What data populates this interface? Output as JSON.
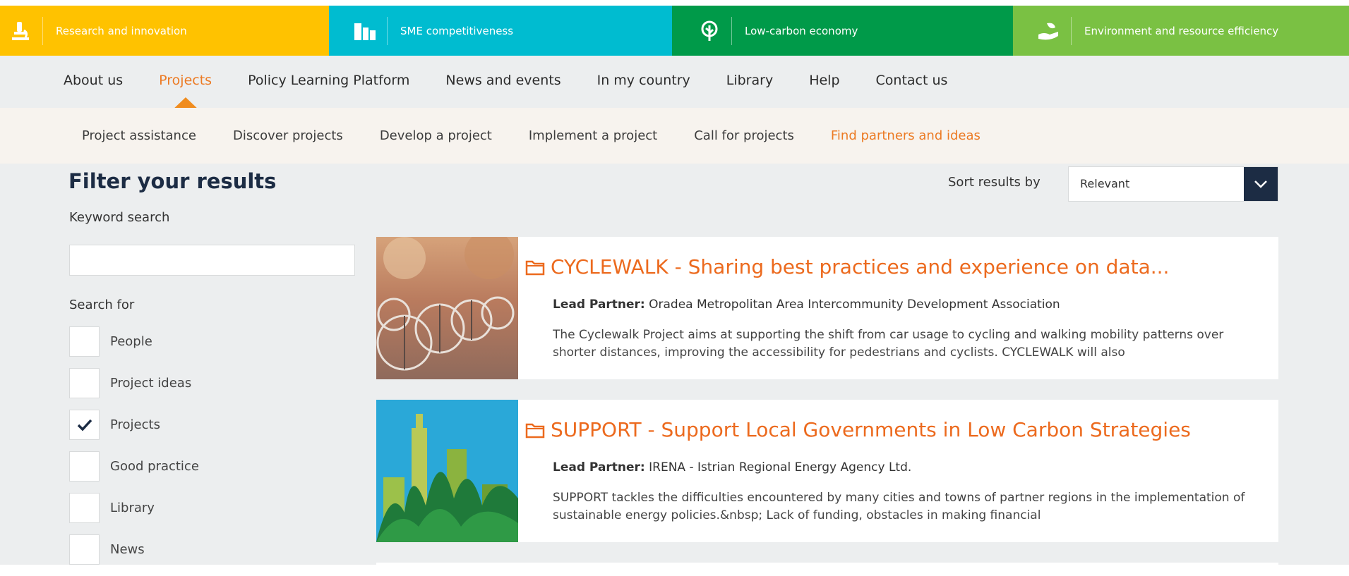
{
  "themes": [
    {
      "label": "Research and innovation",
      "color": "#ffc200",
      "icon": "microscope-icon"
    },
    {
      "label": "SME competitiveness",
      "color": "#00bcd0",
      "icon": "buildings-icon"
    },
    {
      "label": "Low-carbon economy",
      "color": "#009a49",
      "icon": "tree-icon"
    },
    {
      "label": "Environment and resource efficiency",
      "color": "#7ac143",
      "icon": "hand-leaf-icon"
    }
  ],
  "main_nav": {
    "items": [
      "About us",
      "Projects",
      "Policy Learning Platform",
      "News and events",
      "In my country",
      "Library",
      "Help",
      "Contact us"
    ],
    "active": "Projects"
  },
  "sub_nav": {
    "items": [
      "Project assistance",
      "Discover projects",
      "Develop a project",
      "Implement a project",
      "Call for projects",
      "Find partners and ideas"
    ],
    "active": "Find partners and ideas"
  },
  "filters": {
    "title": "Filter your results",
    "keyword_label": "Keyword search",
    "keyword_value": "",
    "search_for_label": "Search for",
    "options": [
      {
        "label": "People",
        "checked": false
      },
      {
        "label": "Project ideas",
        "checked": false
      },
      {
        "label": "Projects",
        "checked": true
      },
      {
        "label": "Good practice",
        "checked": false
      },
      {
        "label": "Library",
        "checked": false
      },
      {
        "label": "News",
        "checked": false
      }
    ]
  },
  "sort": {
    "label": "Sort results by",
    "value": "Relevant"
  },
  "results": [
    {
      "title": "CYCLEWALK - Sharing best practices and experience on data...",
      "lead_partner_label": "Lead Partner:",
      "lead_partner": " Oradea Metropolitan Area Intercommunity Development Association",
      "description": "The Cyclewalk Project aims at supporting the shift from car usage to cycling and walking mobility patterns over shorter distances, improving the accessibility for pedestrians and cyclists. CYCLEWALK will also",
      "image": "bicycles-photo"
    },
    {
      "title": "SUPPORT - Support Local Governments in Low Carbon Strategies",
      "lead_partner_label": "Lead Partner:",
      "lead_partner": " IRENA - Istrian Regional Energy Agency Ltd.",
      "description": "SUPPORT tackles the difficulties encountered by many cities and towns of partner regions in the implementation of sustainable energy policies.&nbsp; Lack of funding, obstacles in making financial",
      "image": "green-city-illustration"
    }
  ]
}
